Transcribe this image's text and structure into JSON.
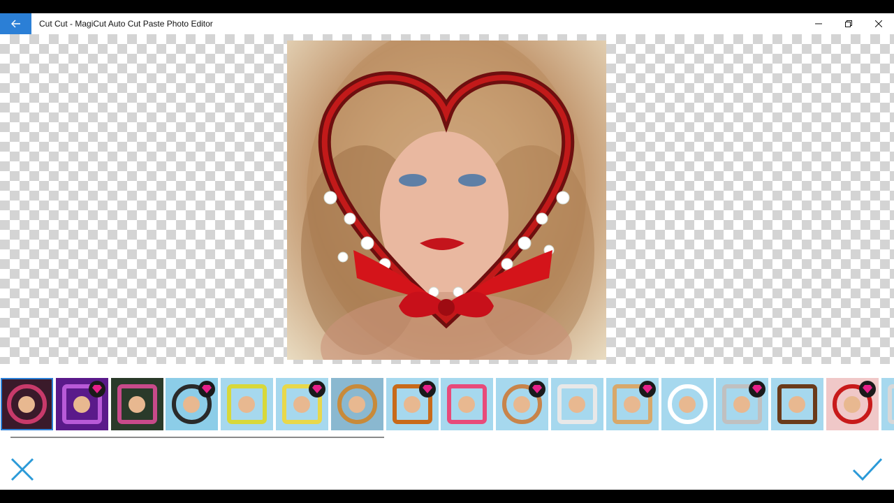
{
  "window": {
    "title": "Cut Cut - MagiCut Auto Cut Paste Photo Editor",
    "accent": "#2b7fd6"
  },
  "icons": {
    "back": "arrow-left-icon",
    "minimize": "minimize-icon",
    "restore": "restore-icon",
    "close": "close-icon",
    "cancel": "x-icon",
    "confirm": "checkmark-icon",
    "premium": "diamond-icon"
  },
  "frames": {
    "selected_index": 0,
    "items": [
      {
        "name": "frame-heart-flowers",
        "premium": false
      },
      {
        "name": "frame-purple-heart",
        "premium": true
      },
      {
        "name": "frame-floral-square",
        "premium": false
      },
      {
        "name": "frame-cassette",
        "premium": true
      },
      {
        "name": "frame-lemon-wreath",
        "premium": false
      },
      {
        "name": "frame-daisy-wreath",
        "premium": true
      },
      {
        "name": "frame-autumn-basket",
        "premium": false
      },
      {
        "name": "frame-autumn-leaves",
        "premium": true
      },
      {
        "name": "frame-pink-roses",
        "premium": false
      },
      {
        "name": "frame-hand-heart",
        "premium": true
      },
      {
        "name": "frame-hands-holding",
        "premium": false
      },
      {
        "name": "frame-fingers-heart",
        "premium": true
      },
      {
        "name": "frame-polaroid",
        "premium": false
      },
      {
        "name": "frame-silver-heart",
        "premium": true
      },
      {
        "name": "frame-tree-border",
        "premium": false
      },
      {
        "name": "frame-red-heart",
        "premium": true
      },
      {
        "name": "frame-partial",
        "premium": false
      }
    ]
  }
}
